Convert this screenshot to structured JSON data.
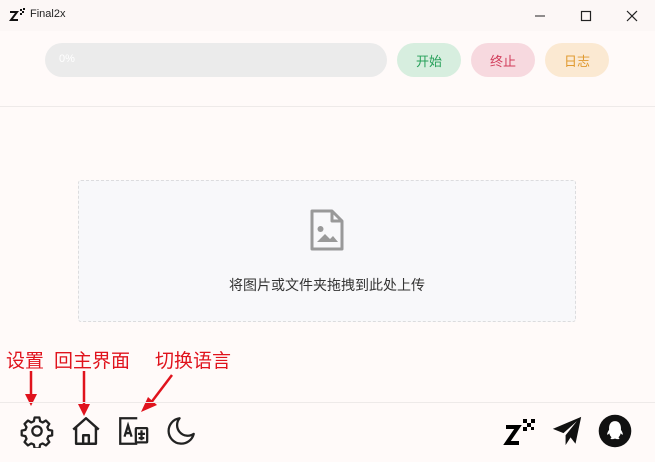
{
  "window": {
    "title": "Final2x"
  },
  "progress": {
    "value": 0,
    "label": "0%"
  },
  "actions": {
    "start": "开始",
    "stop": "终止",
    "log": "日志"
  },
  "dropzone": {
    "text": "将图片或文件夹拖拽到此处上传"
  },
  "annotations": {
    "settings": "设置",
    "home": "回主界面",
    "language": "切换语言"
  },
  "toolbar": {
    "left": [
      "gear-icon",
      "home-icon",
      "translate-icon",
      "moon-icon"
    ],
    "right": [
      "final2x-logo-icon",
      "send-icon",
      "qq-penguin-icon"
    ]
  },
  "colors": {
    "background": "#fffaf9",
    "start": "#27a05a",
    "stop": "#d13c5a",
    "log": "#e09a30",
    "annotation": "#e0131d"
  }
}
